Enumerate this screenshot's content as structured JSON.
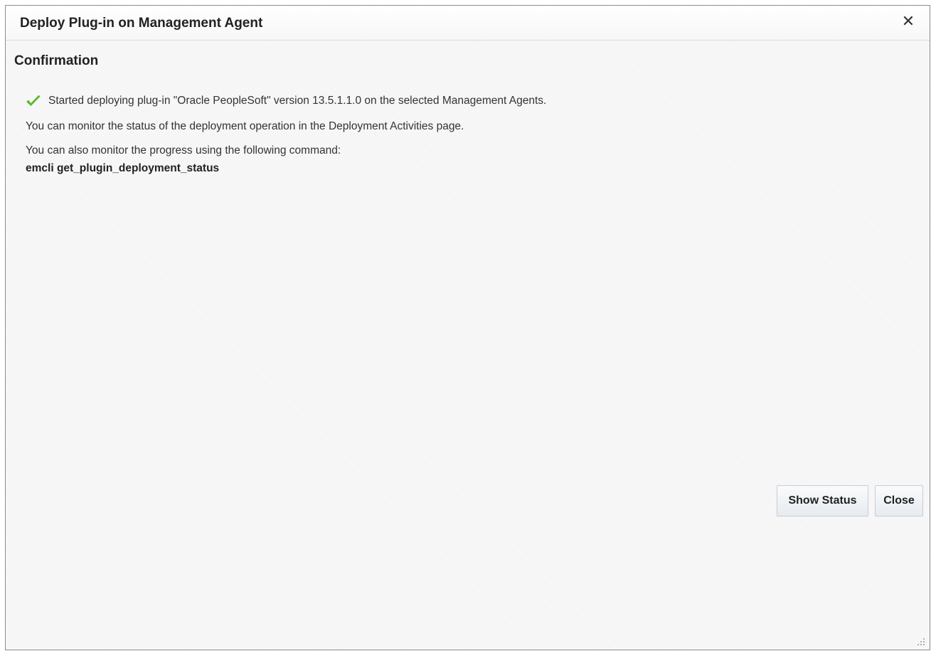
{
  "dialog": {
    "title": "Deploy Plug-in on Management Agent",
    "close_glyph": "✕"
  },
  "content": {
    "heading": "Confirmation",
    "messages": [
      "Started deploying plug-in \"Oracle PeopleSoft\" version 13.5.1.1.0 on the selected Management Agents.",
      "You can monitor the status of the deployment operation in the Deployment Activities page.",
      "You can also monitor the progress using the following command:",
      "emcli get_plugin_deployment_status"
    ]
  },
  "buttons": {
    "show_status": "Show Status",
    "close": "Close"
  },
  "colors": {
    "success_check": "#5cb82e"
  },
  "icons": {
    "success": "checkmark-icon",
    "close": "close-icon",
    "resize": "resize-grip-icon"
  }
}
